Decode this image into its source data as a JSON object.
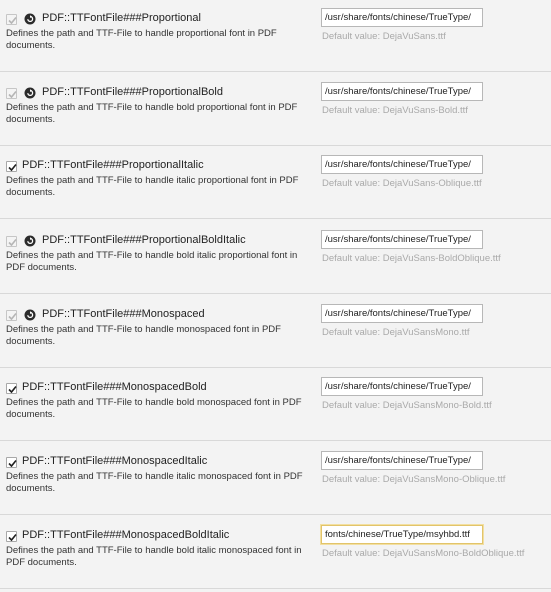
{
  "settings": [
    {
      "title": "PDF::TTFontFile###Proportional",
      "desc": "Defines the path and TTF-File to handle proportional font in PDF documents.",
      "value": "/usr/share/fonts/chinese/TrueType/",
      "default": "Default value: DejaVuSans.ttf",
      "checked": true,
      "modified": false
    },
    {
      "title": "PDF::TTFontFile###ProportionalBold",
      "desc": "Defines the path and TTF-File to handle bold proportional font in PDF documents.",
      "value": "/usr/share/fonts/chinese/TrueType/",
      "default": "Default value: DejaVuSans-Bold.ttf",
      "checked": true,
      "modified": false
    },
    {
      "title": "PDF::TTFontFile###ProportionalItalic",
      "desc": "Defines the path and TTF-File to handle italic proportional font in PDF documents.",
      "value": "/usr/share/fonts/chinese/TrueType/",
      "default": "Default value: DejaVuSans-Oblique.ttf",
      "checked": true,
      "modified": true
    },
    {
      "title": "PDF::TTFontFile###ProportionalBoldItalic",
      "desc": "Defines the path and TTF-File to handle bold italic proportional font in PDF documents.",
      "value": "/usr/share/fonts/chinese/TrueType/",
      "default": "Default value: DejaVuSans-BoldOblique.ttf",
      "checked": true,
      "modified": false
    },
    {
      "title": "PDF::TTFontFile###Monospaced",
      "desc": "Defines the path and TTF-File to handle monospaced font in PDF documents.",
      "value": "/usr/share/fonts/chinese/TrueType/",
      "default": "Default value: DejaVuSansMono.ttf",
      "checked": true,
      "modified": false
    },
    {
      "title": "PDF::TTFontFile###MonospacedBold",
      "desc": "Defines the path and TTF-File to handle bold monospaced font in PDF documents.",
      "value": "/usr/share/fonts/chinese/TrueType/",
      "default": "Default value: DejaVuSansMono-Bold.ttf",
      "checked": true,
      "modified": true
    },
    {
      "title": "PDF::TTFontFile###MonospacedItalic",
      "desc": "Defines the path and TTF-File to handle italic monospaced font in PDF documents.",
      "value": "/usr/share/fonts/chinese/TrueType/",
      "default": "Default value: DejaVuSansMono-Oblique.ttf",
      "checked": true,
      "modified": true
    },
    {
      "title": "PDF::TTFontFile###MonospacedBoldItalic",
      "desc": "Defines the path and TTF-File to handle bold italic monospaced font in PDF documents.",
      "value": "fonts/chinese/TrueType/msyhbd.ttf",
      "default": "Default value: DejaVuSansMono-BoldOblique.ttf",
      "checked": true,
      "modified": true
    }
  ],
  "icons": {
    "reset": "reset-icon",
    "check": "checkmark-icon"
  },
  "colors": {
    "background": "#f3f3f3",
    "default_text": "#a9a9a9",
    "focus_border": "#e2c46a"
  }
}
